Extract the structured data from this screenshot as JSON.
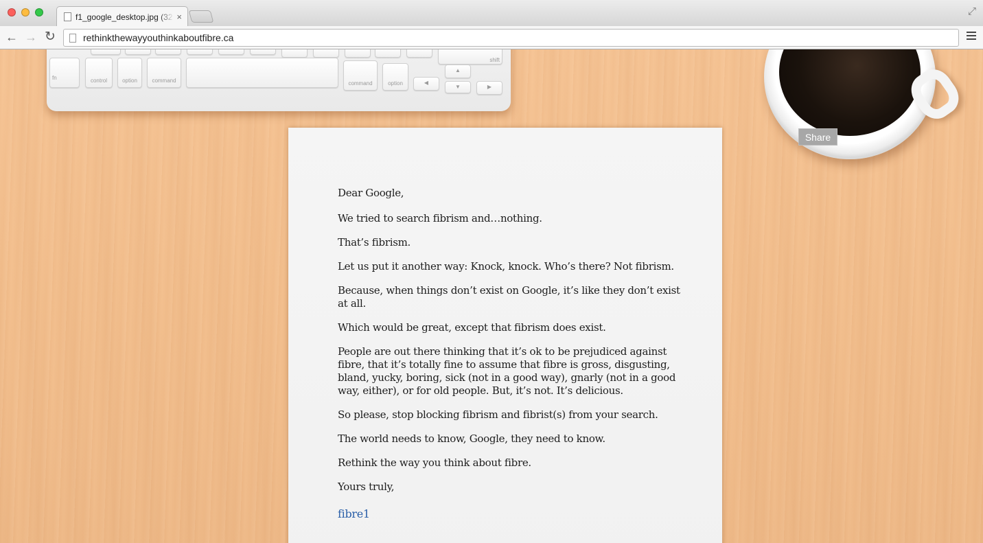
{
  "browser": {
    "tab_title": "f1_google_desktop.jpg (32",
    "tab_close": "×",
    "url": "rethinkthewayyouthinkaboutfibre.ca",
    "icons": [
      "back-arrow-icon",
      "forward-arrow-icon",
      "reload-icon",
      "page-icon",
      "menu-icon",
      "fullscreen-icon"
    ]
  },
  "page": {
    "share_label": "Share",
    "letter": {
      "salutation": "Dear Google,",
      "paragraphs": [
        "We tried to search fibrism and…nothing.",
        "That’s fibrism.",
        "Let us put it another way: Knock, knock. Who’s there? Not fibrism.",
        "Because, when things don’t exist on Google, it’s like they don’t exist at all.",
        "Which would be great, except that fibrism does exist.",
        "People are out there thinking that it’s ok to be prejudiced against fibre, that it’s totally fine to assume that fibre is gross, disgusting, bland, yucky, boring, sick (not in a good way), gnarly (not in a good way, either), or for old people. But, it’s not. It’s delicious.",
        "So please, stop blocking fibrism and fibrist(s) from your search.",
        "The world needs to know, Google, they need to know.",
        "Rethink the way you think about fibre."
      ],
      "signoff": "Yours truly,",
      "signature": "fibre1"
    },
    "keyboard_keys": {
      "fn": "fn",
      "control": "control",
      "option_left": "option",
      "command_left": "command",
      "command_right": "command",
      "option_right": "option",
      "shift": "shift"
    }
  },
  "colors": {
    "desk": "#f3c08f",
    "share_bg": "#a7a7a7",
    "signature": "#2a5fa8"
  }
}
